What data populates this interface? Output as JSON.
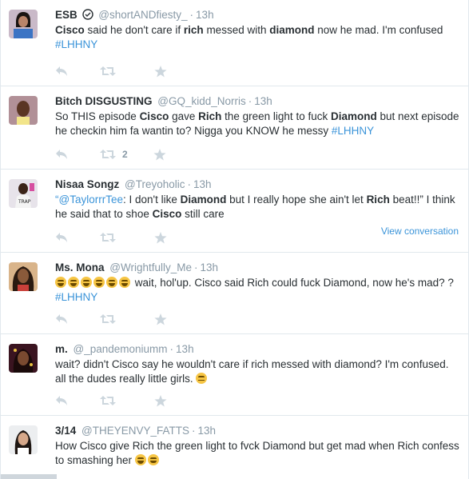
{
  "tweets": [
    {
      "fullname": "ESB",
      "username": "@shortANDfiesty_",
      "time": "13h",
      "text_parts": [
        "Cisco",
        " said he don't care if ",
        "rich",
        " messed with ",
        "diamond",
        " now he mad. I'm confused ",
        "#LHHNY"
      ],
      "retweets": "",
      "view_conversation": ""
    },
    {
      "fullname": "Bitch DISGUSTING",
      "username": "@GQ_kidd_Norris",
      "time": "13h",
      "text_parts": [
        "So THIS episode ",
        "Cisco",
        " gave ",
        "Rich",
        " the green light to fuck ",
        "Diamond",
        " but next episode he checkin him fa wantin to? Nigga you KNOW he messy ",
        "#LHHNY"
      ],
      "retweets": "2",
      "view_conversation": ""
    },
    {
      "fullname": "Nisaa Songz",
      "username": "@Treyoholic",
      "time": "13h",
      "text_parts": [
        "“",
        "@TaylorrrTee",
        ": I don't like ",
        "Diamond",
        " but I really hope she ain't let ",
        "Rich",
        " beat!!” I think he said that to shoe ",
        "Cisco",
        " still care"
      ],
      "retweets": "",
      "view_conversation": "View conversation"
    },
    {
      "fullname": "Ms. Mona",
      "username": "@Wrightfully_Me",
      "time": "13h",
      "text_parts": [
        " wait, hol'up.  Cisco said Rich could fuck  Diamond, now he's mad? ? ",
        "#LHHNY"
      ],
      "retweets": "",
      "view_conversation": ""
    },
    {
      "fullname": "m.",
      "username": "@_pandemoniumm",
      "time": "13h",
      "text_parts": [
        "wait? didn't Cisco say he wouldn't care if rich messed with diamond? I'm confused. all the dudes really little girls. "
      ],
      "retweets": "",
      "view_conversation": ""
    },
    {
      "fullname": "3/14",
      "username": "@THEYENVY_FATTS",
      "time": "13h",
      "text_parts": [
        "How Cisco give Rich the green light to fvck Diamond but get mad when Rich confess to smashing her "
      ],
      "retweets": "",
      "view_conversation": ""
    }
  ],
  "icons": {
    "reply": "reply-icon",
    "retweet": "retweet-icon",
    "favorite": "star-icon",
    "verified": "verified-badge-icon"
  },
  "colors": {
    "link": "#3b94d9",
    "muted": "#8899a6",
    "text": "#292f33",
    "border": "#e1e8ed",
    "action_icon": "#ccd6dd"
  }
}
